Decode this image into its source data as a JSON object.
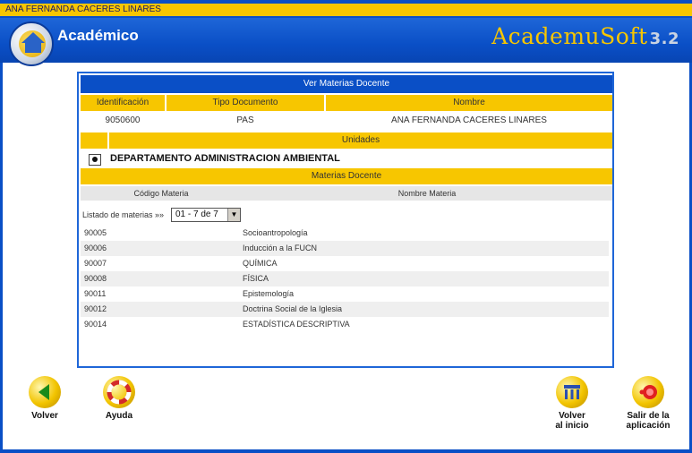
{
  "user": {
    "name": "ANA FERNANDA CACERES LINARES"
  },
  "header": {
    "title": "Académico",
    "brand": "AcademuSoft",
    "version": "3.2"
  },
  "panel": {
    "title": "Ver Materias Docente",
    "columns": {
      "id": "Identificación",
      "doc_type": "Tipo Documento",
      "name": "Nombre"
    },
    "teacher": {
      "id": "9050600",
      "doc_type": "PAS",
      "name": "ANA FERNANDA CACERES LINARES"
    },
    "units_label": "Unidades",
    "department": "DEPARTAMENTO ADMINISTRACION AMBIENTAL",
    "subjects_label": "Materias Docente",
    "subject_columns": {
      "code": "Código Materia",
      "name": "Nombre Materia"
    },
    "listing_label": "Listado de materias »»",
    "listing_selected": "01 - 7 de 7",
    "subjects": [
      {
        "code": "90005",
        "name": "Socioantropología"
      },
      {
        "code": "90006",
        "name": "Inducción a la FUCN"
      },
      {
        "code": "90007",
        "name": "QUÍMICA"
      },
      {
        "code": "90008",
        "name": "FÍSICA"
      },
      {
        "code": "90011",
        "name": "Epistemología"
      },
      {
        "code": "90012",
        "name": "Doctrina Social de la Iglesia"
      },
      {
        "code": "90014",
        "name": "ESTADÍSTICA DESCRIPTIVA"
      }
    ]
  },
  "nav": {
    "back": "Volver",
    "help": "Ayuda",
    "home_line1": "Volver",
    "home_line2": "al inicio",
    "exit_line1": "Salir de la",
    "exit_line2": "aplicación"
  },
  "colors": {
    "primary": "#0a4fc6",
    "accent": "#f7c600",
    "row_alt": "#efefef"
  }
}
